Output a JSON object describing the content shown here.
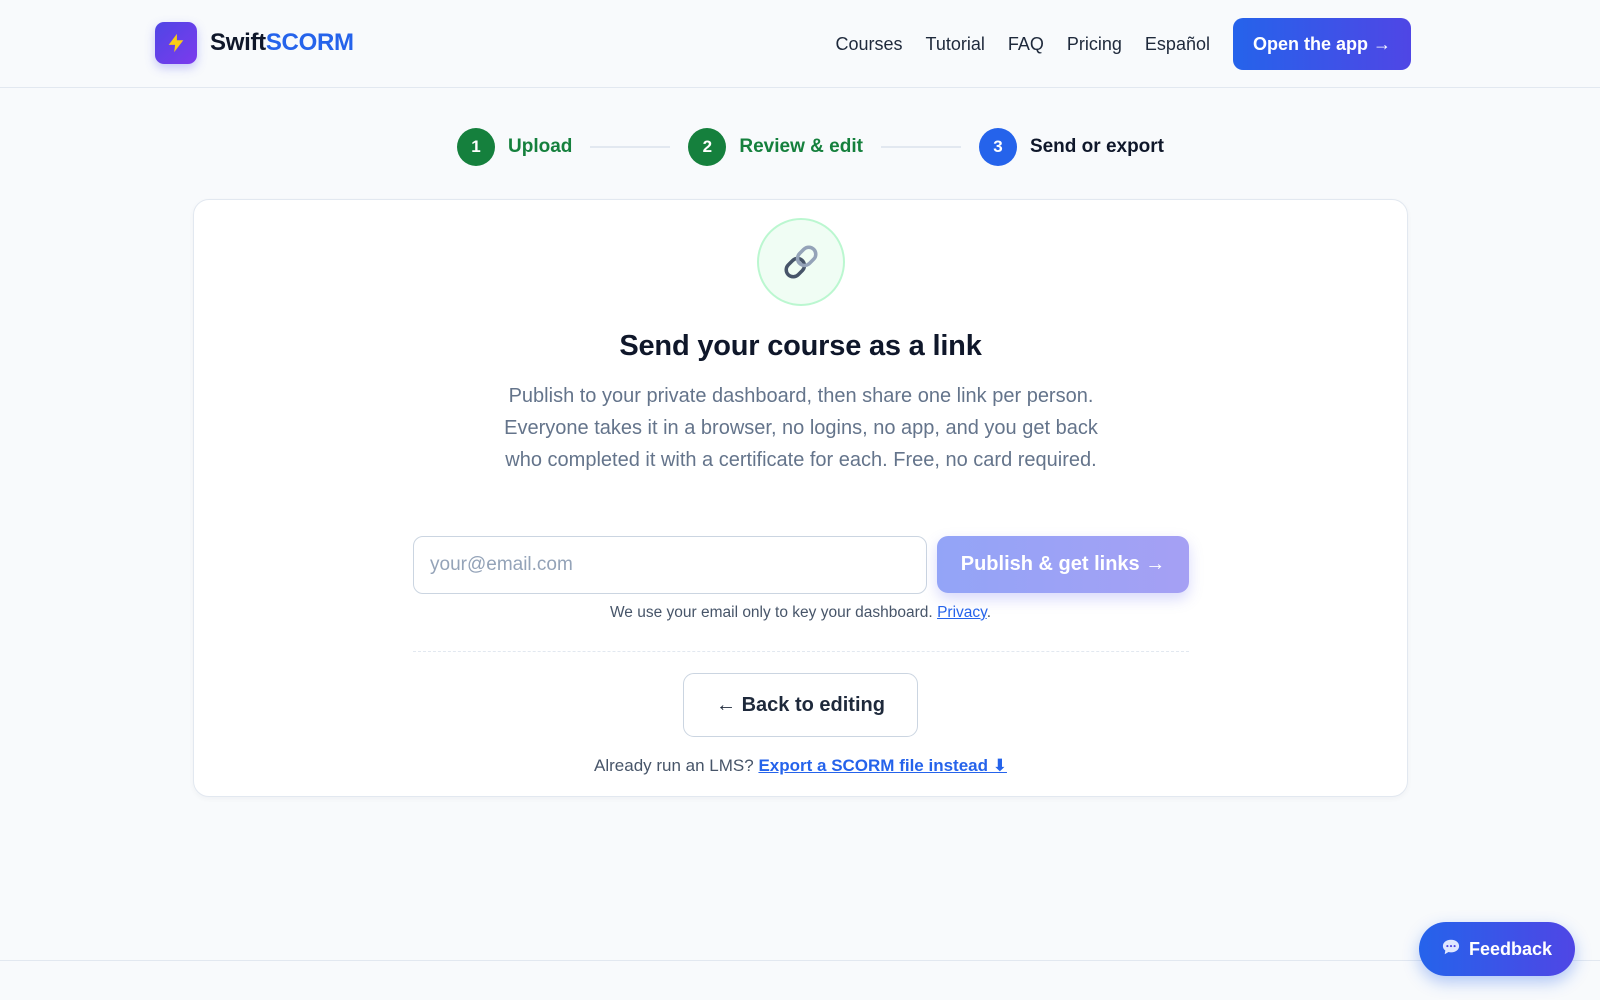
{
  "header": {
    "brand_swift": "Swift",
    "brand_scorm": "SCORM",
    "logo_icon": "lightning-bolt-icon",
    "nav": [
      {
        "label": "Courses"
      },
      {
        "label": "Tutorial"
      },
      {
        "label": "FAQ"
      },
      {
        "label": "Pricing"
      },
      {
        "label": "Español"
      }
    ],
    "cta_label": "Open the app →"
  },
  "stepper": {
    "steps": [
      {
        "number": "1",
        "label": "Upload",
        "state": "done"
      },
      {
        "number": "2",
        "label": "Review & edit",
        "state": "done"
      },
      {
        "number": "3",
        "label": "Send or export",
        "state": "active"
      }
    ]
  },
  "card": {
    "icon": "link-icon",
    "title": "Send your course as a link",
    "description": "Publish to your private dashboard, then share one link per person. Everyone takes it in a browser, no logins, no app, and you get back who completed it with a certificate for each. Free, no card required.",
    "email": {
      "value": "",
      "placeholder": "your@email.com"
    },
    "publish_label": "Publish & get links →",
    "email_note_prefix": "We use your email only to key your dashboard.",
    "email_note_link": "Privacy",
    "email_note_suffix": ".",
    "back_label": "← Back to editing",
    "lms_prefix": "Already run an LMS?",
    "lms_link": "Export a SCORM file instead ⬇"
  },
  "feedback": {
    "label": "Feedback",
    "icon": "chat-bubble-icon"
  },
  "colors": {
    "brand_blue": "#2563eb",
    "done_green": "#15803d",
    "indigo": "#4f46e5"
  }
}
